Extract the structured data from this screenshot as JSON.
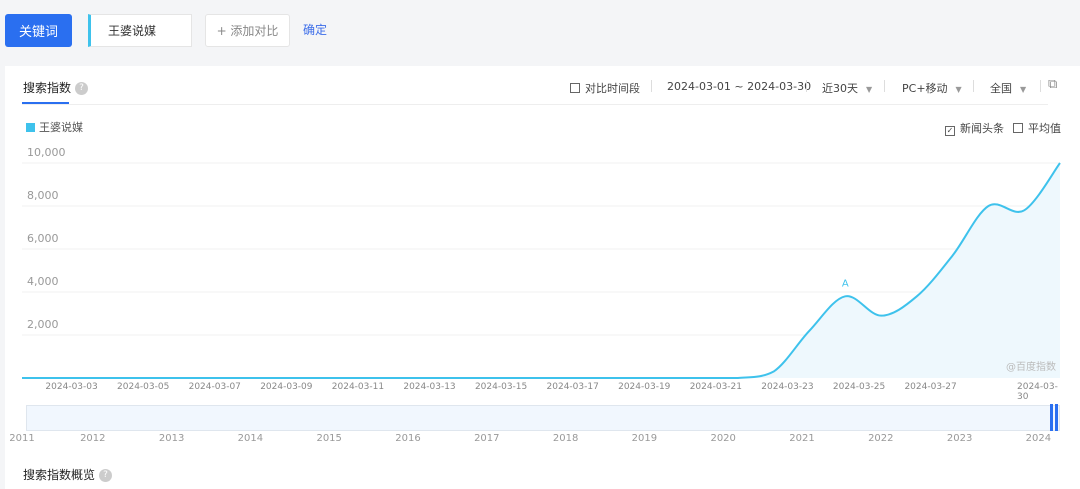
{
  "top": {
    "keyword_button": "关键词",
    "keyword_value": "王婆说媒",
    "add_compare": "+ 添加对比",
    "confirm": "确定"
  },
  "panel": {
    "tab": "搜索指数",
    "help": "?",
    "compare_period": "对比时间段",
    "date_range": "2024-03-01 ~ 2024-03-30",
    "period": "近30天",
    "device": "PC+移动",
    "region": "全国",
    "news_label": "新闻头条",
    "avg_label": "平均值",
    "watermark": "@百度指数",
    "overview_title": "搜索指数概览"
  },
  "chart_data": {
    "type": "line",
    "legend": [
      "王婆说媒"
    ],
    "color": "#3ec2ec",
    "ylim": [
      0,
      10000
    ],
    "yticks": [
      "2,000",
      "4,000",
      "6,000",
      "8,000",
      "10,000"
    ],
    "yticks_values": [
      2000,
      4000,
      6000,
      8000,
      10000
    ],
    "x": [
      "2024-03-01",
      "2024-03-02",
      "2024-03-03",
      "2024-03-04",
      "2024-03-05",
      "2024-03-06",
      "2024-03-07",
      "2024-03-08",
      "2024-03-09",
      "2024-03-10",
      "2024-03-11",
      "2024-03-12",
      "2024-03-13",
      "2024-03-14",
      "2024-03-15",
      "2024-03-16",
      "2024-03-17",
      "2024-03-18",
      "2024-03-19",
      "2024-03-20",
      "2024-03-21",
      "2024-03-22",
      "2024-03-23",
      "2024-03-24",
      "2024-03-25",
      "2024-03-26",
      "2024-03-27",
      "2024-03-28",
      "2024-03-29",
      "2024-03-30"
    ],
    "values": [
      0,
      0,
      0,
      0,
      0,
      0,
      0,
      0,
      0,
      0,
      0,
      0,
      0,
      0,
      0,
      0,
      0,
      0,
      0,
      0,
      0,
      300,
      2200,
      3800,
      2900,
      3800,
      5700,
      8000,
      7800,
      10000
    ],
    "xtick_labels": [
      "2024-03-03",
      "2024-03-05",
      "2024-03-07",
      "2024-03-09",
      "2024-03-11",
      "2024-03-13",
      "2024-03-15",
      "2024-03-17",
      "2024-03-19",
      "2024-03-21",
      "2024-03-23",
      "2024-03-25",
      "2024-03-27",
      "2024-03-30"
    ],
    "annotation": {
      "label": "A",
      "date": "2024-03-24"
    },
    "brush_years": [
      "2011",
      "2012",
      "2013",
      "2014",
      "2015",
      "2016",
      "2017",
      "2018",
      "2019",
      "2020",
      "2021",
      "2022",
      "2023",
      "2024"
    ]
  }
}
